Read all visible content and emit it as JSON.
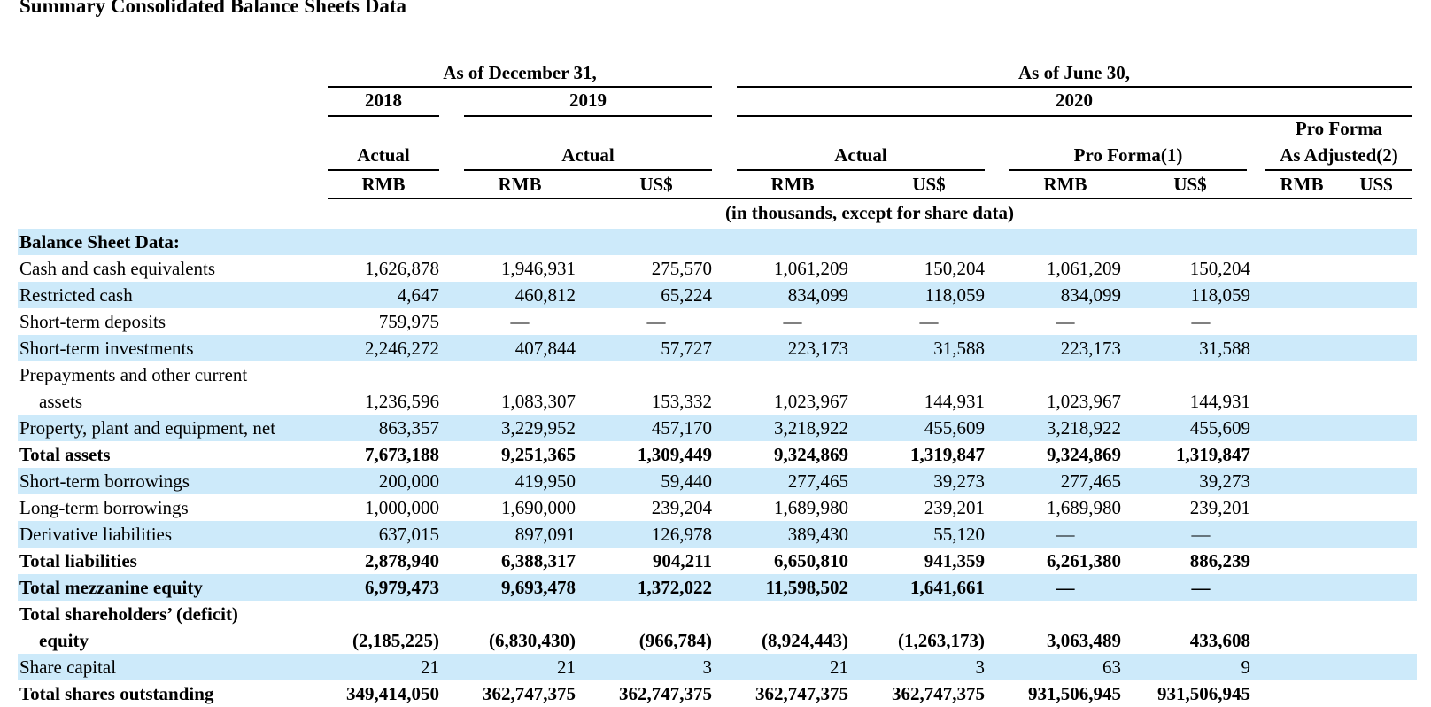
{
  "title": "Summary Consolidated Balance Sheets Data",
  "header": {
    "dec": "As of December 31,",
    "jun": "As of June 30,",
    "y2018": "2018",
    "y2019": "2019",
    "y2020": "2020",
    "actual": "Actual",
    "pro_forma": "Pro Forma(1)",
    "pfaa_1": "Pro Forma",
    "pfaa_2": "As Adjusted(2)",
    "rmb": "RMB",
    "usd": "US$",
    "note": "(in thousands, except for share data)"
  },
  "section_label": "Balance Sheet Data:",
  "rows": [
    {
      "label": "Cash and cash equivalents",
      "values": [
        "1,626,878",
        "1,946,931",
        "275,570",
        "1,061,209",
        "150,204",
        "1,061,209",
        "150,204"
      ]
    },
    {
      "label": "Restricted cash",
      "values": [
        "4,647",
        "460,812",
        "65,224",
        "834,099",
        "118,059",
        "834,099",
        "118,059"
      ]
    },
    {
      "label": "Short-term deposits",
      "values": [
        "759,975",
        "—",
        "—",
        "—",
        "—",
        "—",
        "—"
      ]
    },
    {
      "label": "Short-term investments",
      "values": [
        "2,246,272",
        "407,844",
        "57,727",
        "223,173",
        "31,588",
        "223,173",
        "31,588"
      ]
    },
    {
      "label": "Prepayments and other current",
      "label2": "assets",
      "values": [
        "1,236,596",
        "1,083,307",
        "153,332",
        "1,023,967",
        "144,931",
        "1,023,967",
        "144,931"
      ]
    },
    {
      "label": "Property, plant and equipment, net",
      "values": [
        "863,357",
        "3,229,952",
        "457,170",
        "3,218,922",
        "455,609",
        "3,218,922",
        "455,609"
      ]
    },
    {
      "label": "Total assets",
      "values": [
        "7,673,188",
        "9,251,365",
        "1,309,449",
        "9,324,869",
        "1,319,847",
        "9,324,869",
        "1,319,847"
      ]
    },
    {
      "label": "Short-term borrowings",
      "values": [
        "200,000",
        "419,950",
        "59,440",
        "277,465",
        "39,273",
        "277,465",
        "39,273"
      ]
    },
    {
      "label": "Long-term borrowings",
      "values": [
        "1,000,000",
        "1,690,000",
        "239,204",
        "1,689,980",
        "239,201",
        "1,689,980",
        "239,201"
      ]
    },
    {
      "label": "Derivative liabilities",
      "values": [
        "637,015",
        "897,091",
        "126,978",
        "389,430",
        "55,120",
        "—",
        "—"
      ]
    },
    {
      "label": "Total liabilities",
      "values": [
        "2,878,940",
        "6,388,317",
        "904,211",
        "6,650,810",
        "941,359",
        "6,261,380",
        "886,239"
      ]
    },
    {
      "label": "Total mezzanine equity",
      "values": [
        "6,979,473",
        "9,693,478",
        "1,372,022",
        "11,598,502",
        "1,641,661",
        "—",
        "—"
      ]
    },
    {
      "label": "Total shareholders’ (deficit)",
      "label2": "equity",
      "values": [
        "(2,185,225)",
        "(6,830,430)",
        "(966,784)",
        "(8,924,443)",
        "(1,263,173)",
        "3,063,489",
        "433,608"
      ]
    },
    {
      "label": "Share capital",
      "values": [
        "21",
        "21",
        "3",
        "21",
        "3",
        "63",
        "9"
      ]
    },
    {
      "label": "Total shares outstanding",
      "values": [
        "349,414,050",
        "362,747,375",
        "362,747,375",
        "362,747,375",
        "362,747,375",
        "931,506,945",
        "931,506,945"
      ]
    }
  ]
}
